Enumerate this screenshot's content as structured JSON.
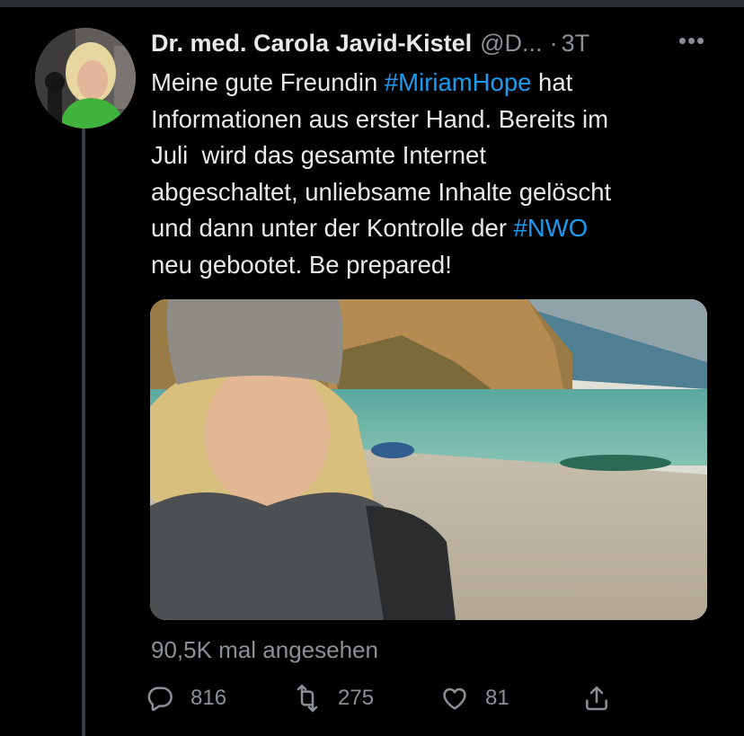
{
  "tweet": {
    "author_name": "Dr. med. Carola Javid-Kistel",
    "handle": "@D...",
    "separator": "·",
    "time": "3T",
    "more_label": "•••",
    "text": {
      "part1": "Meine gute Freundin ",
      "hashtag1": "#MiriamHope",
      "part2": " hat",
      "line2": "Informationen aus erster Hand. Bereits im",
      "line3": "Juli  wird das gesamte Internet",
      "line4": "abgeschaltet, unliebsame Inhalte gelöscht",
      "line5a": "und dann unter der Kontrolle der ",
      "hashtag2": "#NWO",
      "line6": "neu gebootet. Be prepared!"
    },
    "views": "90,5K mal angesehen",
    "actions": {
      "replies": "816",
      "retweets": "275",
      "likes": "81"
    }
  },
  "colors": {
    "background": "#000000",
    "text_primary": "#e7e9ea",
    "text_secondary": "#8b9096",
    "link": "#1d9bf0"
  },
  "icons": [
    "more-icon",
    "reply-icon",
    "retweet-icon",
    "like-icon",
    "share-icon"
  ]
}
